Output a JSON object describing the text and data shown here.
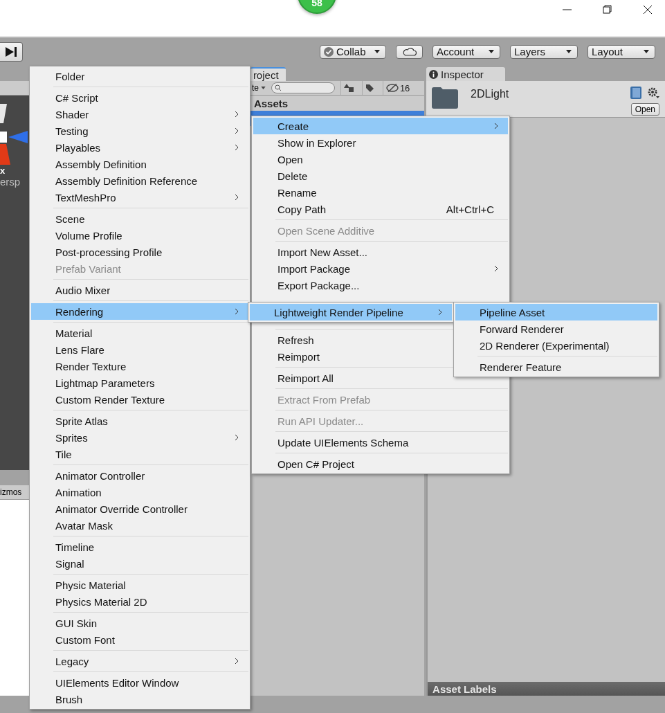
{
  "title_bar": {
    "badge": "58"
  },
  "toolbar": {
    "buttons": [
      {
        "label": "Collab",
        "kind": "collab"
      },
      {
        "kind": "cloud"
      },
      {
        "label": "Account",
        "kind": "dropdown"
      },
      {
        "label": "Layers",
        "kind": "dropdown"
      },
      {
        "label": "Layout",
        "kind": "dropdown"
      }
    ]
  },
  "scene_panel": {
    "axis_label": "x",
    "projection": "ersp",
    "toolbar_label": "izmos"
  },
  "project_panel": {
    "tab": "roject",
    "create_dropdown": "te",
    "hidden_count": "16",
    "header": "Assets"
  },
  "inspector": {
    "tab": "Inspector",
    "asset_name": "2DLight",
    "open_button": "Open",
    "footer": "Asset Labels"
  },
  "create_menu": {
    "groups": [
      [
        {
          "label": "Folder",
          "submenu": false,
          "disabled": false,
          "selected": false
        }
      ],
      [
        {
          "label": "C# Script",
          "submenu": false,
          "disabled": false,
          "selected": false
        },
        {
          "label": "Shader",
          "submenu": true,
          "disabled": false,
          "selected": false
        },
        {
          "label": "Testing",
          "submenu": true,
          "disabled": false,
          "selected": false
        },
        {
          "label": "Playables",
          "submenu": true,
          "disabled": false,
          "selected": false
        },
        {
          "label": "Assembly Definition",
          "submenu": false,
          "disabled": false,
          "selected": false
        },
        {
          "label": "Assembly Definition Reference",
          "submenu": false,
          "disabled": false,
          "selected": false
        },
        {
          "label": "TextMeshPro",
          "submenu": true,
          "disabled": false,
          "selected": false
        }
      ],
      [
        {
          "label": "Scene",
          "submenu": false,
          "disabled": false,
          "selected": false
        },
        {
          "label": "Volume Profile",
          "submenu": false,
          "disabled": false,
          "selected": false
        },
        {
          "label": "Post-processing Profile",
          "submenu": false,
          "disabled": false,
          "selected": false
        },
        {
          "label": "Prefab Variant",
          "submenu": false,
          "disabled": true,
          "selected": false
        }
      ],
      [
        {
          "label": "Audio Mixer",
          "submenu": false,
          "disabled": false,
          "selected": false
        }
      ],
      [
        {
          "label": "Rendering",
          "submenu": true,
          "disabled": false,
          "selected": true
        }
      ],
      [
        {
          "label": "Material",
          "submenu": false,
          "disabled": false,
          "selected": false
        },
        {
          "label": "Lens Flare",
          "submenu": false,
          "disabled": false,
          "selected": false
        },
        {
          "label": "Render Texture",
          "submenu": false,
          "disabled": false,
          "selected": false
        },
        {
          "label": "Lightmap Parameters",
          "submenu": false,
          "disabled": false,
          "selected": false
        },
        {
          "label": "Custom Render Texture",
          "submenu": false,
          "disabled": false,
          "selected": false
        }
      ],
      [
        {
          "label": "Sprite Atlas",
          "submenu": false,
          "disabled": false,
          "selected": false
        },
        {
          "label": "Sprites",
          "submenu": true,
          "disabled": false,
          "selected": false
        },
        {
          "label": "Tile",
          "submenu": false,
          "disabled": false,
          "selected": false
        }
      ],
      [
        {
          "label": "Animator Controller",
          "submenu": false,
          "disabled": false,
          "selected": false
        },
        {
          "label": "Animation",
          "submenu": false,
          "disabled": false,
          "selected": false
        },
        {
          "label": "Animator Override Controller",
          "submenu": false,
          "disabled": false,
          "selected": false
        },
        {
          "label": "Avatar Mask",
          "submenu": false,
          "disabled": false,
          "selected": false
        }
      ],
      [
        {
          "label": "Timeline",
          "submenu": false,
          "disabled": false,
          "selected": false
        },
        {
          "label": "Signal",
          "submenu": false,
          "disabled": false,
          "selected": false
        }
      ],
      [
        {
          "label": "Physic Material",
          "submenu": false,
          "disabled": false,
          "selected": false
        },
        {
          "label": "Physics Material 2D",
          "submenu": false,
          "disabled": false,
          "selected": false
        }
      ],
      [
        {
          "label": "GUI Skin",
          "submenu": false,
          "disabled": false,
          "selected": false
        },
        {
          "label": "Custom Font",
          "submenu": false,
          "disabled": false,
          "selected": false
        }
      ],
      [
        {
          "label": "Legacy",
          "submenu": true,
          "disabled": false,
          "selected": false
        }
      ],
      [
        {
          "label": "UIElements Editor Window",
          "submenu": false,
          "disabled": false,
          "selected": false
        },
        {
          "label": "Brush",
          "submenu": false,
          "disabled": false,
          "selected": false
        }
      ]
    ]
  },
  "context_menu": {
    "groups": [
      [
        {
          "label": "Create",
          "submenu": true,
          "disabled": false,
          "selected": true
        },
        {
          "label": "Show in Explorer",
          "submenu": false,
          "disabled": false,
          "selected": false
        },
        {
          "label": "Open",
          "submenu": false,
          "disabled": false,
          "selected": false
        },
        {
          "label": "Delete",
          "submenu": false,
          "disabled": false,
          "selected": false
        },
        {
          "label": "Rename",
          "submenu": false,
          "disabled": false,
          "selected": false
        },
        {
          "label": "Copy Path",
          "shortcut": "Alt+Ctrl+C",
          "submenu": false,
          "disabled": false,
          "selected": false
        }
      ],
      [
        {
          "label": "Open Scene Additive",
          "submenu": false,
          "disabled": true,
          "selected": false
        }
      ],
      [
        {
          "label": "Import New Asset...",
          "submenu": false,
          "disabled": false,
          "selected": false
        },
        {
          "label": "Import Package",
          "submenu": true,
          "disabled": false,
          "selected": false
        },
        {
          "label": "Export Package...",
          "submenu": false,
          "disabled": false,
          "selected": false
        }
      ],
      [
        {
          "label": "Refresh",
          "disabled": false,
          "selected": false
        },
        {
          "label": "Reimport",
          "disabled": false,
          "selected": false
        }
      ],
      [
        {
          "label": "Reimport All",
          "submenu": false,
          "disabled": false,
          "selected": false
        }
      ],
      [
        {
          "label": "Extract From Prefab",
          "submenu": false,
          "disabled": true,
          "selected": false
        }
      ],
      [
        {
          "label": "Run API Updater...",
          "submenu": false,
          "disabled": true,
          "selected": false
        }
      ],
      [
        {
          "label": "Update UIElements Schema",
          "submenu": false,
          "disabled": false,
          "selected": false
        }
      ],
      [
        {
          "label": "Open C# Project",
          "submenu": false,
          "disabled": false,
          "selected": false
        }
      ]
    ]
  },
  "rendering_submenu": {
    "groups": [
      [
        {
          "label": "Lightweight Render Pipeline",
          "submenu": true,
          "disabled": false,
          "selected": true
        }
      ]
    ]
  },
  "pipeline_submenu": {
    "groups": [
      [
        {
          "label": "Pipeline Asset",
          "submenu": false,
          "disabled": false,
          "selected": true
        },
        {
          "label": "Forward Renderer",
          "submenu": false,
          "disabled": false,
          "selected": false
        },
        {
          "label": "2D Renderer (Experimental)",
          "submenu": false,
          "disabled": false,
          "selected": false
        }
      ],
      [
        {
          "label": "Renderer Feature",
          "submenu": false,
          "disabled": false,
          "selected": false
        }
      ]
    ]
  }
}
